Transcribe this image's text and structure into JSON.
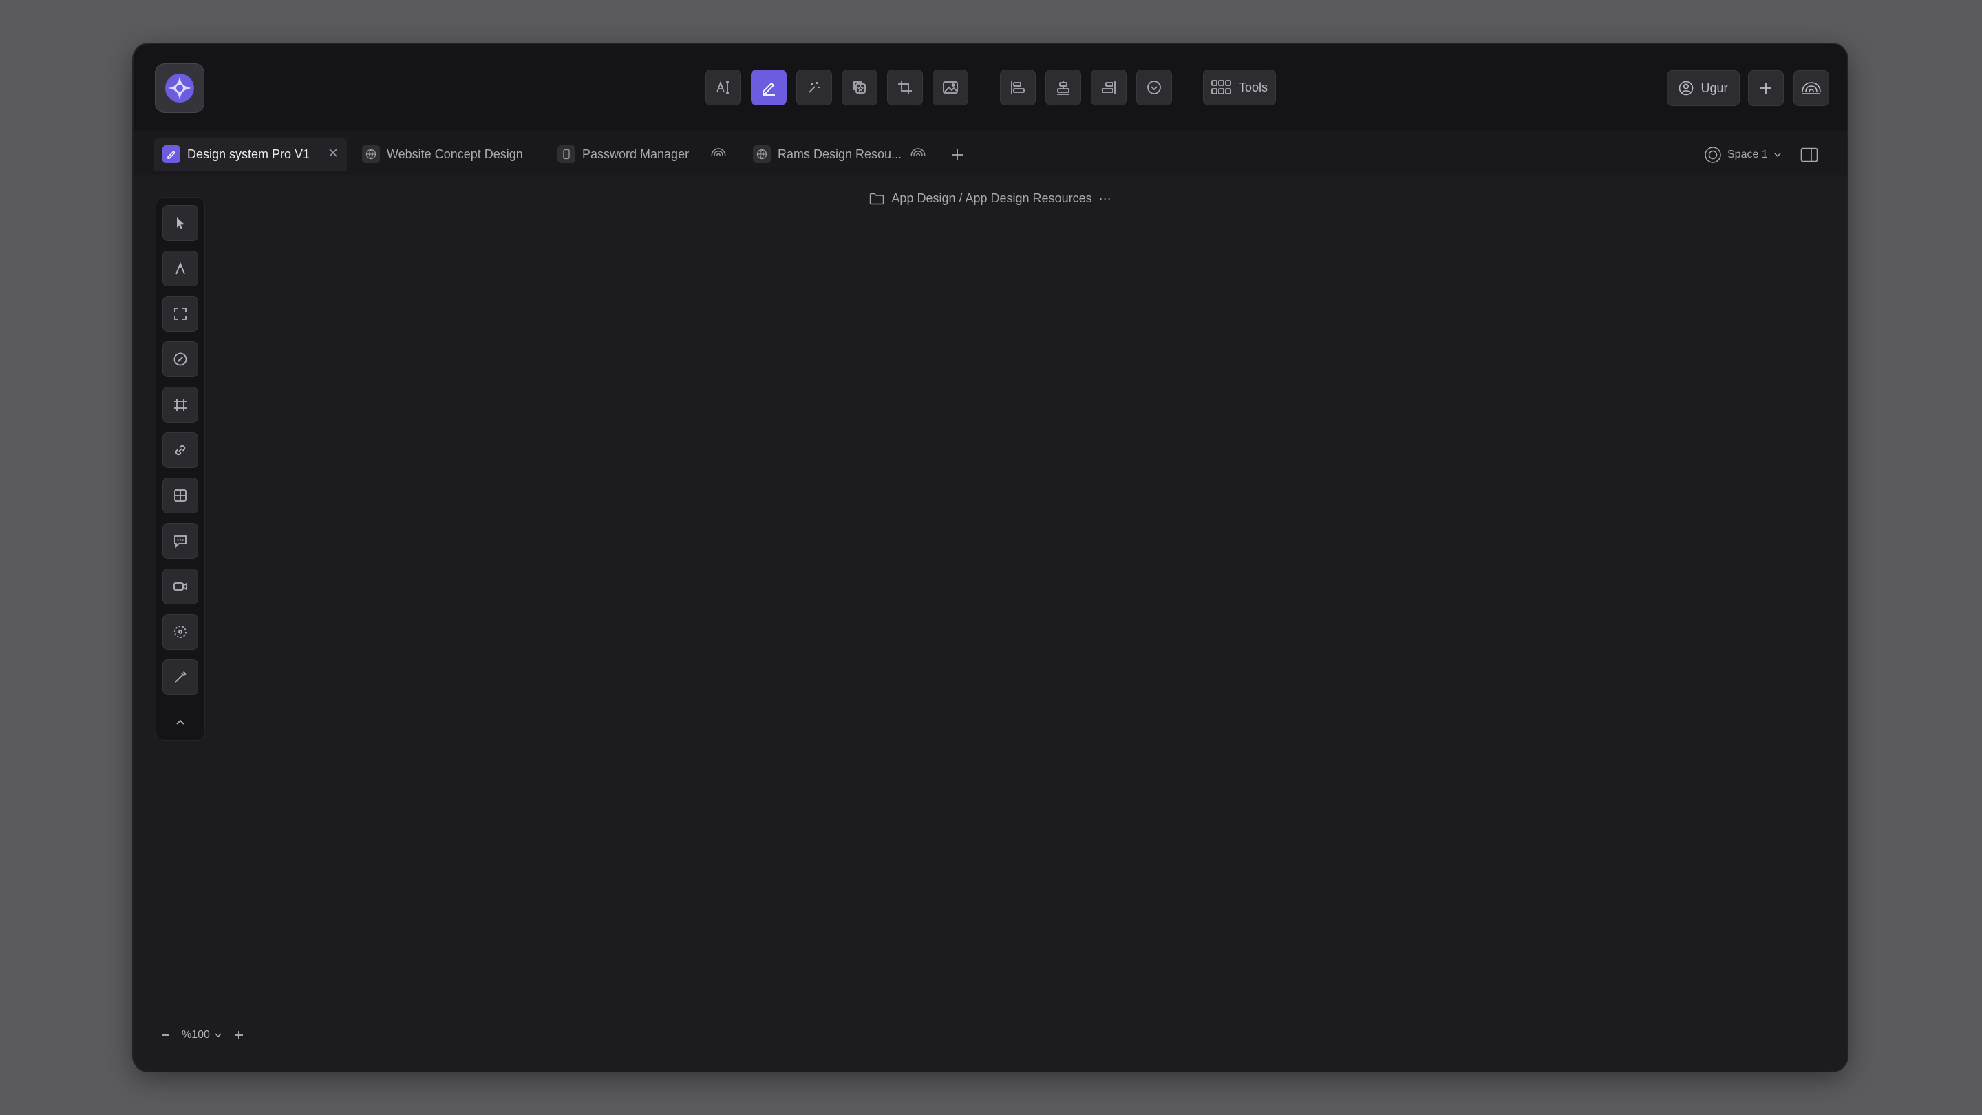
{
  "toolbar": {
    "buttons": [
      {
        "icon": "text-icon"
      },
      {
        "icon": "pen-icon",
        "active": true
      },
      {
        "icon": "magic-icon"
      },
      {
        "icon": "layers-star-icon"
      },
      {
        "icon": "crop-icon"
      },
      {
        "icon": "image-icon"
      },
      {
        "icon": "align-left-icon"
      },
      {
        "icon": "align-center-icon"
      },
      {
        "icon": "align-right-icon"
      },
      {
        "icon": "check-circle-icon"
      }
    ],
    "tools_label": "Tools",
    "user_label": "Ugur"
  },
  "tabs": [
    {
      "label": "Design system Pro V1",
      "active": true
    },
    {
      "label": "Website Concept Design"
    },
    {
      "label": "Password Manager"
    },
    {
      "label": "Rams Design Resou..."
    }
  ],
  "space": {
    "label": "Space 1"
  },
  "breadcrumb": {
    "text": "App Design / App Design Resources",
    "more": "···"
  },
  "zoom": {
    "value": "%100"
  },
  "colors": {
    "accent": "#6c5ce0",
    "background": "#1c1c1f",
    "desktop": "#5b5b5e"
  }
}
